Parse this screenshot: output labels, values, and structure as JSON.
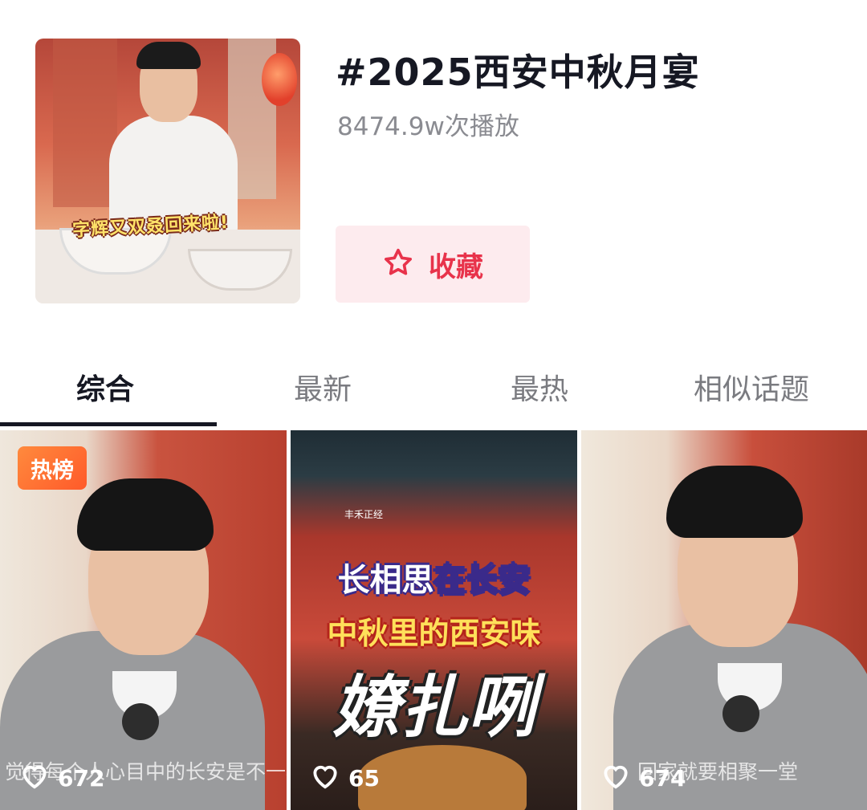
{
  "header": {
    "cover_caption": "字辉又双叒回来啦!",
    "topic_title": "#2025西安中秋月宴",
    "play_count": "8474.9w次播放",
    "favorite_button": {
      "label": "收藏",
      "icon": "star-outline-icon"
    }
  },
  "tabs": [
    {
      "label": "综合",
      "active": true
    },
    {
      "label": "最新",
      "active": false
    },
    {
      "label": "最热",
      "active": false
    },
    {
      "label": "相似话题",
      "active": false
    }
  ],
  "videos": [
    {
      "badge": "热榜",
      "subtitle": "觉得每个人心目中的长安是不一样",
      "likes": "672"
    },
    {
      "overlay": {
        "line1_a": "长相思",
        "line1_b": "在长安",
        "line2": "中秋里的西安味",
        "line3": "嫽扎咧"
      },
      "brand": "丰禾正经",
      "likes": "65"
    },
    {
      "subtitle": "回家就要相聚一堂",
      "likes": "674"
    }
  ],
  "colors": {
    "accent": "#e8334b",
    "favorite_bg": "#fdebee",
    "hot_badge": "#ff6a2f"
  }
}
